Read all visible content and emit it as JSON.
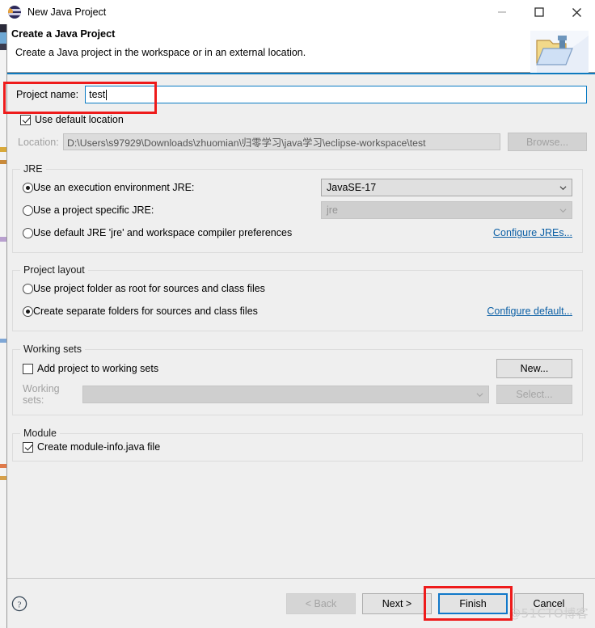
{
  "window": {
    "title": "New Java Project",
    "app_icon": "eclipse-icon",
    "controls": {
      "minimize": "minimize-icon",
      "maximize": "maximize-icon",
      "close": "close-icon"
    }
  },
  "header": {
    "title": "Create a Java Project",
    "description": "Create a Java project in the workspace or in an external location.",
    "icon": "java-project-folder-icon"
  },
  "project": {
    "name_label": "Project name:",
    "name_value": "test",
    "use_default_location_label": "Use default location",
    "use_default_location_checked": true,
    "location_label": "Location:",
    "location_value": "D:\\Users\\s97929\\Downloads\\zhuomian\\归零学习\\java学习\\eclipse-workspace\\test",
    "browse_label": "Browse..."
  },
  "jre": {
    "group_title": "JRE",
    "options": [
      {
        "label": "Use an execution environment JRE:",
        "selected": true
      },
      {
        "label": "Use a project specific JRE:",
        "selected": false
      },
      {
        "label": "Use default JRE 'jre' and workspace compiler preferences",
        "selected": false
      }
    ],
    "execution_env_value": "JavaSE-17",
    "project_jre_value": "jre",
    "configure_link": "Configure JREs..."
  },
  "layout": {
    "group_title": "Project layout",
    "options": [
      {
        "label": "Use project folder as root for sources and class files",
        "selected": false
      },
      {
        "label": "Create separate folders for sources and class files",
        "selected": true
      }
    ],
    "configure_link": "Configure default..."
  },
  "working_sets": {
    "group_title": "Working sets",
    "add_label": "Add project to working sets",
    "add_checked": false,
    "new_label": "New...",
    "sets_label": "Working sets:",
    "sets_value": "",
    "select_label": "Select..."
  },
  "module": {
    "group_title": "Module",
    "create_label": "Create module-info.java file",
    "create_checked": true
  },
  "footer": {
    "help": "help-icon",
    "back_label": "< Back",
    "next_label": "Next >",
    "finish_label": "Finish",
    "cancel_label": "Cancel"
  },
  "watermark": "@51CTO博客",
  "annotations": {
    "highlight_color": "#ee1b1b",
    "focus_color": "#0a7bc4"
  }
}
